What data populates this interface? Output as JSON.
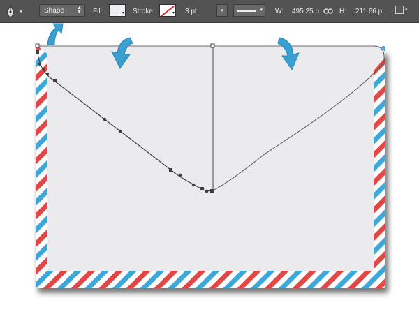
{
  "toolbar": {
    "tool_icon": "pen-tool-icon",
    "mode": "Shape",
    "fill_label": "Fill:",
    "fill_color": "#efeef1",
    "stroke_label": "Stroke:",
    "stroke_color": "none",
    "stroke_width": "3 pt",
    "width_label": "W:",
    "width_value": "495.25 p",
    "height_label": "H:",
    "height_value": "211.66 p",
    "link_icon": "link-icon",
    "path_ops_icon": "path-operations-icon"
  },
  "canvas": {
    "envelope": {
      "body_color": "#ebebee",
      "stripe_red": "#e04745",
      "stripe_blue": "#3ea7d9",
      "shadow_color": "#5a5a5a"
    },
    "annotations": {
      "arrow_color": "#3aa0d2",
      "arrows": [
        "arrow-to-shape-dropdown",
        "arrow-left-flap",
        "arrow-right-flap"
      ]
    }
  }
}
